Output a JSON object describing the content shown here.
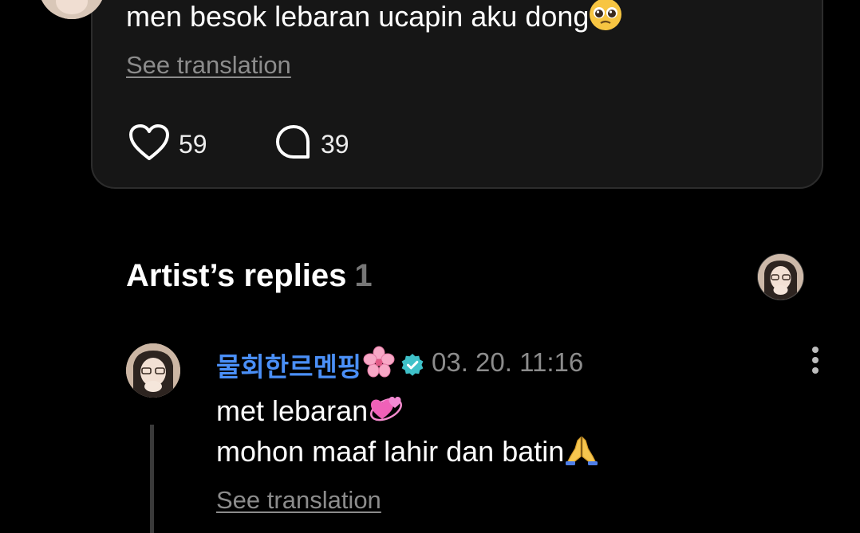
{
  "post": {
    "text": "men besok lebaran ucapin aku dong",
    "text_emoji": "pleading-face-emoji",
    "see_translation": "See translation",
    "likes": "59",
    "comments": "39"
  },
  "artist_replies": {
    "title": "Artist’s replies",
    "count": "1"
  },
  "reply": {
    "author": "물회한르멘핑",
    "author_emoji": "cherry-blossom-emoji",
    "verified_icon": "verified-badge-icon",
    "timestamp": "03. 20. 11:16",
    "line1": "met lebaran",
    "line1_emoji": "revolving-hearts-emoji",
    "line2": "mohon maaf lahir dan batin",
    "line2_emoji": "folded-hands-emoji",
    "see_translation": "See translation"
  },
  "colors": {
    "background": "#000000",
    "card": "#161616",
    "card_border": "#2c2c2c",
    "author_name": "#4a8ff7",
    "verified_badge": "#3fc1c9",
    "muted_text": "#8c8c8c"
  }
}
